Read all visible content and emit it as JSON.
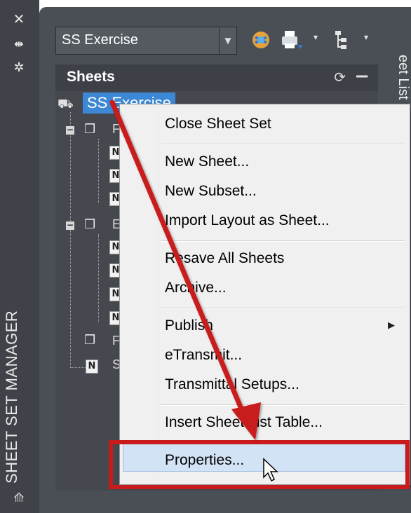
{
  "side_strip": {
    "title": "SHEET SET MANAGER",
    "icons": [
      "close-icon",
      "auto-hide-icon",
      "properties-icon",
      "collapse-icon"
    ]
  },
  "toolbar": {
    "sheet_set_dropdown": {
      "value": "SS Exercise"
    },
    "icons": [
      "publish-to-dwf-icon",
      "plot-icon",
      "sheet-selections-icon"
    ]
  },
  "side_tab": {
    "label": "eet List"
  },
  "sheets_panel": {
    "title": "Sheets"
  },
  "tree": {
    "root": {
      "label": "SS Exercise"
    },
    "subsets": [
      {
        "label": "F"
      },
      {
        "label": "E"
      },
      {
        "label": "F"
      }
    ],
    "sheet_marker": "N",
    "loose_sheet": {
      "label": "S"
    }
  },
  "context_menu": {
    "items": [
      {
        "label": "Close Sheet Set"
      },
      {
        "label": "New Sheet..."
      },
      {
        "label": "New Subset..."
      },
      {
        "label": "Import Layout as Sheet..."
      },
      {
        "label": "Resave All Sheets"
      },
      {
        "label": "Archive..."
      },
      {
        "label": "Publish",
        "submenu": true
      },
      {
        "label": "eTransmit..."
      },
      {
        "label": "Transmittal Setups..."
      },
      {
        "label": "Insert Sheet List Table..."
      },
      {
        "label": "Properties...",
        "highlighted": true
      }
    ]
  },
  "annotation": {
    "arrow_color": "#c91b1b",
    "highlight_color": "#c91b1b"
  },
  "colors": {
    "panel_dark": "#3f4248",
    "selection_blue": "#3c88d6",
    "menu_bg": "#f0f0f0"
  }
}
